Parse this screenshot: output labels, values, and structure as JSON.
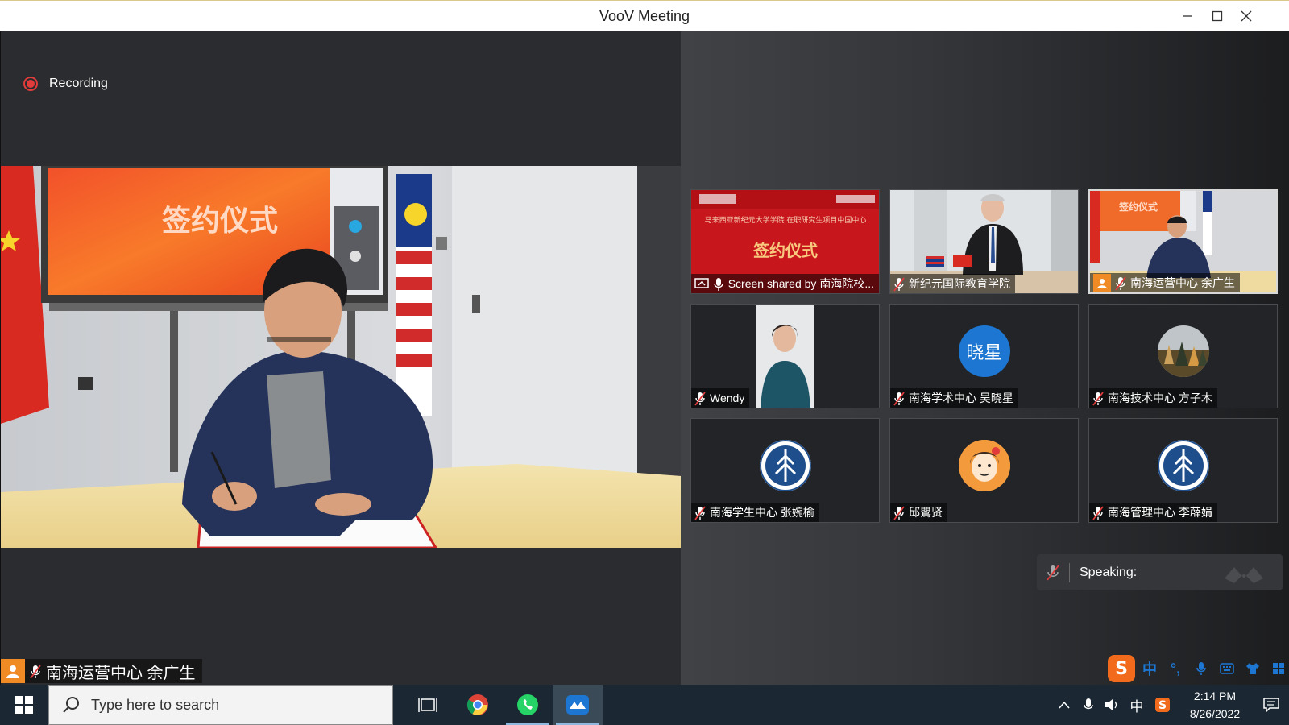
{
  "window": {
    "title": "VooV Meeting"
  },
  "recording": {
    "label": "Recording"
  },
  "main_video": {
    "banner_text": "签约仪式",
    "speaker_label": "南海运营中心 余广生"
  },
  "tiles": [
    {
      "label": "Screen shared by 南海院校...",
      "type": "screen-share",
      "slide_header": "马来西亚新纪元大学学院 在职研究生项目中国中心",
      "slide_title": "签约仪式"
    },
    {
      "label": "新纪元国际教育学院",
      "type": "video"
    },
    {
      "label": "南海运营中心 余广生",
      "type": "video",
      "active": true
    },
    {
      "label": "Wendy",
      "type": "video"
    },
    {
      "label": "南海学术中心 吴晓星",
      "type": "avatar-text",
      "avatar_text": "晓星"
    },
    {
      "label": "南海技术中心 方子木",
      "type": "avatar-image"
    },
    {
      "label": "南海学生中心 张婉榆",
      "type": "avatar-logo"
    },
    {
      "label": "邱鸎贤",
      "type": "avatar-cartoon"
    },
    {
      "label": "南海管理中心 李薜娟",
      "type": "avatar-logo"
    }
  ],
  "speaking": {
    "label": "Speaking:"
  },
  "taskbar": {
    "search_placeholder": "Type here to search",
    "apps": [
      "task-view",
      "chrome",
      "whatsapp",
      "voov-meeting"
    ]
  },
  "tray": {
    "ime_indicator": "中",
    "time": "2:14 PM",
    "date": "8/26/2022"
  },
  "ime_toolbar": {
    "lang": "中",
    "punct": "°,"
  },
  "colors": {
    "accent": "#1d76d2",
    "record": "#e23b3b",
    "avatar_orange": "#f08a24"
  }
}
